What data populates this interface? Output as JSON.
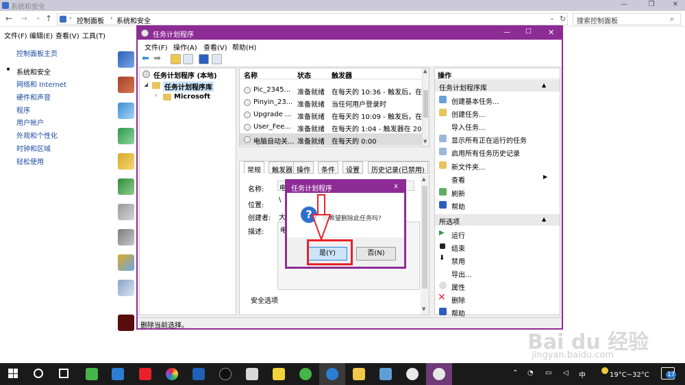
{
  "outer_window": {
    "title": "系统和安全",
    "breadcrumb": [
      "控制面板",
      "系统和安全"
    ],
    "search_placeholder": "搜索控制面板",
    "menu": [
      "文件(F)",
      "编辑(E)",
      "查看(V)",
      "工具(T)"
    ],
    "nav_links": [
      "控制面板主页",
      "系统和安全",
      "网络和 Internet",
      "硬件和声音",
      "程序",
      "用户帐户",
      "外观和个性化",
      "时钟和区域",
      "轻松使用"
    ],
    "active_nav": "系统和安全"
  },
  "task_scheduler": {
    "title": "任务计划程序",
    "menu": [
      "文件(F)",
      "操作(A)",
      "查看(V)",
      "帮助(H)"
    ],
    "tree": {
      "root": "任务计划程序 (本地)",
      "library": "任务计划程序库",
      "child": "Microsoft"
    },
    "columns": [
      "名称",
      "状态",
      "触发器"
    ],
    "tasks": [
      {
        "name": "Pic_2345...",
        "status": "准备就绪",
        "trigger": "在每天的 10:36 - 触发后，在"
      },
      {
        "name": "Pinyin_23...",
        "status": "准备就绪",
        "trigger": "当任何用户登录时"
      },
      {
        "name": "Upgrade ...",
        "status": "准备就绪",
        "trigger": "在每天的 10:09 - 触发后，在"
      },
      {
        "name": "User_Fee...",
        "status": "准备就绪",
        "trigger": "在每天的 1:04 - 触发器在 20"
      },
      {
        "name": "电脑自动关...",
        "status": "准备就绪",
        "trigger": "在每天的 0:00"
      }
    ],
    "detail_tabs": [
      "常规",
      "触发器",
      "操作",
      "条件",
      "设置",
      "历史记录(已禁用)"
    ],
    "detail_fields": {
      "name_label": "名称:",
      "name_value": "电",
      "location_label": "位置:",
      "location_value": "\\",
      "author_label": "创建者:",
      "author_value": "大",
      "desc_label": "描述:",
      "desc_value": "电"
    },
    "security_label": "安全选项",
    "actions_header": "操作",
    "actions_section1": "任务计划程序库",
    "actions1": [
      "创建基本任务...",
      "创建任务...",
      "导入任务...",
      "显示所有正在运行的任务",
      "启用所有任务历史记录",
      "新文件夹...",
      "查看",
      "刷新",
      "帮助"
    ],
    "actions_section2": "所选项",
    "actions2": [
      "运行",
      "结束",
      "禁用",
      "导出...",
      "属性",
      "删除",
      "帮助"
    ],
    "status_text": "删除当前选择。"
  },
  "dialog": {
    "title": "任务计划程序",
    "close": "x",
    "message": "你希望删除此任务吗?",
    "yes": "是(Y)",
    "no": "否(N)"
  },
  "taskbar": {
    "ime": "中",
    "weather": "19°C~32°C",
    "badge": "17"
  },
  "watermark": {
    "brand": "Bai du 经验",
    "url": "jingyan.baidu.com"
  },
  "colors": {
    "accent": "#8d2c95",
    "highlight": "#cce4f7",
    "red": "#e8212a"
  }
}
